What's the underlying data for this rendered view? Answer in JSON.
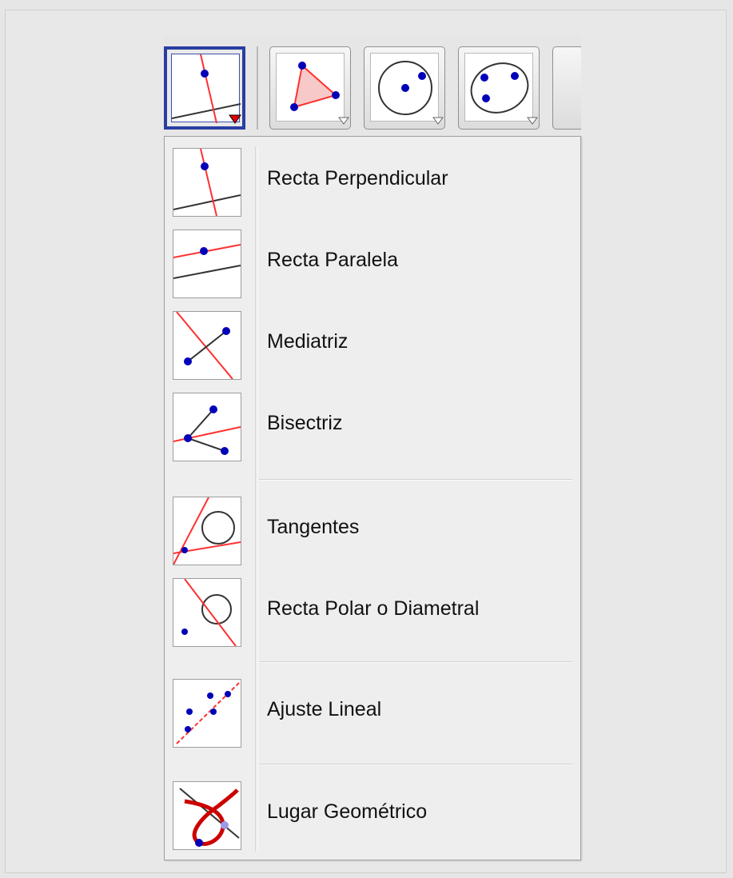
{
  "menu": {
    "items": [
      {
        "label": "Recta Perpendicular",
        "icon": "perpendicular-line-icon"
      },
      {
        "label": "Recta Paralela",
        "icon": "parallel-line-icon"
      },
      {
        "label": "Mediatriz",
        "icon": "perpendicular-bisector-icon"
      },
      {
        "label": "Bisectriz",
        "icon": "angle-bisector-icon"
      },
      {
        "label": "Tangentes",
        "icon": "tangents-icon"
      },
      {
        "label": "Recta Polar o Diametral",
        "icon": "polar-line-icon"
      },
      {
        "label": "Ajuste Lineal",
        "icon": "best-fit-line-icon"
      },
      {
        "label": "Lugar Geométrico",
        "icon": "locus-icon"
      }
    ]
  },
  "toolbar": {
    "buttons": [
      {
        "icon": "perpendicular-line-icon",
        "active": true
      },
      {
        "icon": "polygon-icon",
        "active": false
      },
      {
        "icon": "circle-center-point-icon",
        "active": false
      },
      {
        "icon": "conic-five-points-icon",
        "active": false
      }
    ]
  },
  "colors": {
    "point": "#0000b8",
    "construct": "#ff3030",
    "line": "#333333",
    "active_border": "#2a3ea0"
  }
}
